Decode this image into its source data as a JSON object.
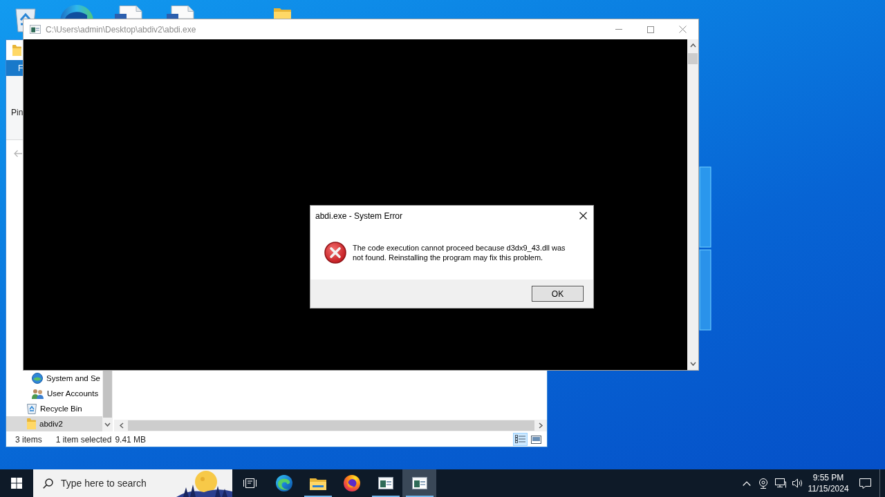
{
  "explorer": {
    "ribbon_tab": "F",
    "ribbon_command": "Pin",
    "nav_tree": [
      {
        "children": [
          {
            "label": "System and Se",
            "kind": "control-panel",
            "selected": false
          },
          {
            "label": "User Accounts",
            "kind": "users",
            "selected": false
          }
        ]
      },
      {
        "label": "Recycle Bin",
        "kind": "recycle-bin",
        "selected": false
      },
      {
        "label": "abdiv2",
        "kind": "folder",
        "selected": true
      }
    ],
    "status_bar": {
      "item_count": "3 items",
      "selection": "1 item selected",
      "size": "9.41 MB"
    },
    "view_modes": [
      {
        "kind": "details",
        "selected": true
      },
      {
        "kind": "large-icons",
        "selected": false
      }
    ]
  },
  "console": {
    "title": "C:\\Users\\admin\\Desktop\\abdiv2\\abdi.exe"
  },
  "dialog": {
    "title": "abdi.exe - System Error",
    "message": "The code execution cannot proceed because d3dx9_43.dll was not found. Reinstalling the program may fix this problem.",
    "button": "OK"
  },
  "taskbar": {
    "search": {
      "placeholder": "Type here to search"
    },
    "apps": [
      {
        "kind": "edge",
        "running": false,
        "active": false
      },
      {
        "kind": "file-explorer",
        "running": true,
        "active": false
      },
      {
        "kind": "firefox",
        "running": false,
        "active": false
      },
      {
        "kind": "console",
        "running": true,
        "active": false
      },
      {
        "kind": "console",
        "running": true,
        "active": true
      }
    ],
    "time": "9:55 PM",
    "date": "11/15/2024"
  }
}
